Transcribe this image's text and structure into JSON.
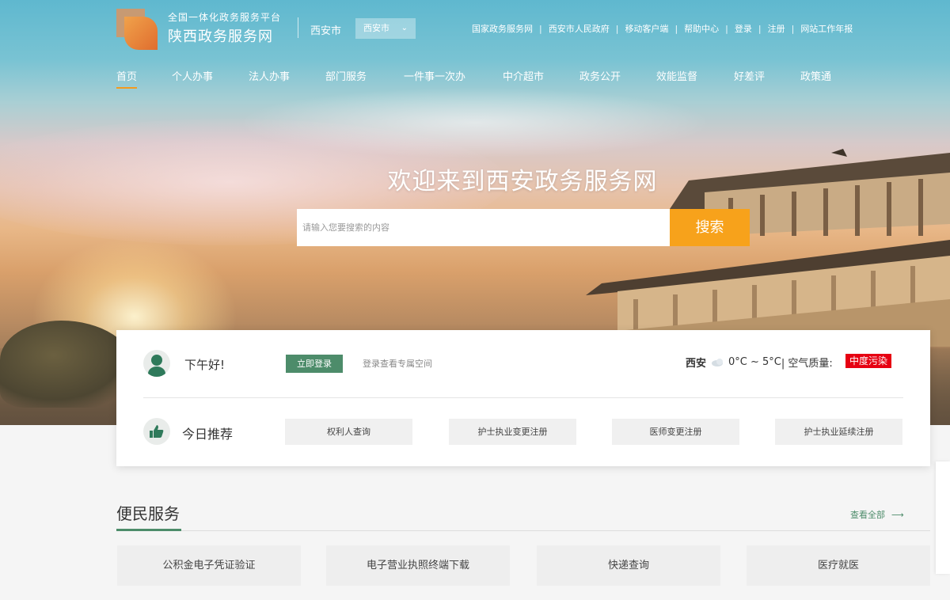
{
  "header": {
    "logo_line1": "全国一体化政务服务平台",
    "logo_line2": "陕西政务服务网",
    "city_label": "西安市",
    "city_select": "西安市",
    "top_links": [
      "国家政务服务网",
      "西安市人民政府",
      "移动客户端",
      "帮助中心",
      "登录",
      "注册",
      "网站工作年报"
    ]
  },
  "nav": {
    "items": [
      "首页",
      "个人办事",
      "法人办事",
      "部门服务",
      "一件事一次办",
      "中介超市",
      "政务公开",
      "效能监督",
      "好差评",
      "政策通"
    ],
    "active_index": 0
  },
  "hero": {
    "title": "欢迎来到西安政务服务网",
    "search_placeholder": "请输入您要搜索的内容",
    "search_button": "搜索"
  },
  "user_card": {
    "greeting": "下午好!",
    "login_button": "立即登录",
    "login_hint": "登录查看专属空间",
    "weather_city": "西安",
    "weather_temp": "0°C ~ 5°C",
    "air_quality_label": "| 空气质量:",
    "air_quality_value": "中度污染",
    "recommend_title": "今日推荐",
    "recommend_items": [
      "权利人查询",
      "护士执业变更注册",
      "医师变更注册",
      "护士执业延续注册"
    ]
  },
  "convenience": {
    "title": "便民服务",
    "view_all": "查看全部",
    "items": [
      "公积金电子凭证验证",
      "电子营业执照终端下载",
      "快递查询",
      "医疗就医"
    ]
  },
  "colors": {
    "accent_green": "#4d8c6a",
    "search_orange": "#f7a21b",
    "nav_active": "#f39a1e",
    "pollution_red": "#e60012"
  }
}
